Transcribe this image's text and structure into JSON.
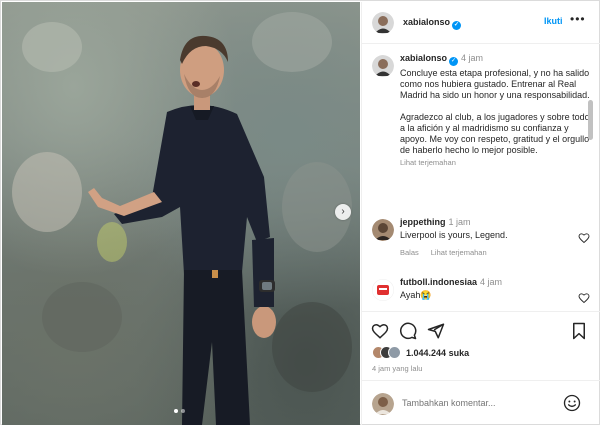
{
  "post": {
    "author": "xabialonso",
    "follow_label": "Ikuti",
    "more_label": "•••",
    "caption_time": "4 jam",
    "caption_text": "Concluye esta etapa profesional, y no ha salido como nos hubiera gustado. Entrenar al Real Madrid ha sido un honor y una responsabilidad.\n\nAgradezco al club, a los jugadores y sobre todo a la afición y al madridismo su confianza y apoyo. Me voy con respeto, gratitud y el orgullo de haberlo hecho lo mejor posible.",
    "translate_label": "Lihat terjemahan"
  },
  "comments": [
    {
      "author": "jeppething",
      "time": "1 jam",
      "text": "Liverpool is yours, Legend.",
      "reply_label": "Balas",
      "translate_label": "Lihat terjemahan"
    },
    {
      "author": "futboll.indonesiaa",
      "time": "4 jam",
      "text": "Ayah😭"
    }
  ],
  "engagement": {
    "likes_count": "1.044.244",
    "likes_suffix": "suka",
    "posted_ago": "4 jam yang lalu"
  },
  "composer": {
    "placeholder": "Tambahkan komentar..."
  },
  "carousel": {
    "next_glyph": "›",
    "slide_count": 2,
    "active_index": 0
  },
  "colors": {
    "link_blue": "#0095f6",
    "verified_blue": "#0095f6",
    "muted_text": "#8e8e8e",
    "primary_text": "#262626"
  }
}
